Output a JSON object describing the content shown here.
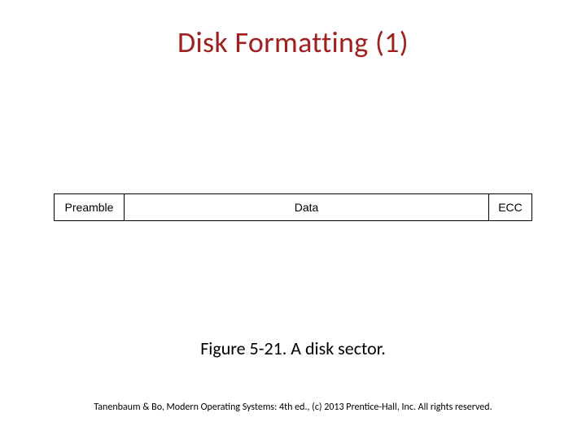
{
  "title": "Disk Formatting (1)",
  "diagram": {
    "cells": [
      "Preamble",
      "Data",
      "ECC"
    ]
  },
  "caption": "Figure 5-21. A disk sector.",
  "footer": "Tanenbaum & Bo, Modern Operating Systems: 4th ed., (c) 2013 Prentice-Hall, Inc. All rights reserved."
}
